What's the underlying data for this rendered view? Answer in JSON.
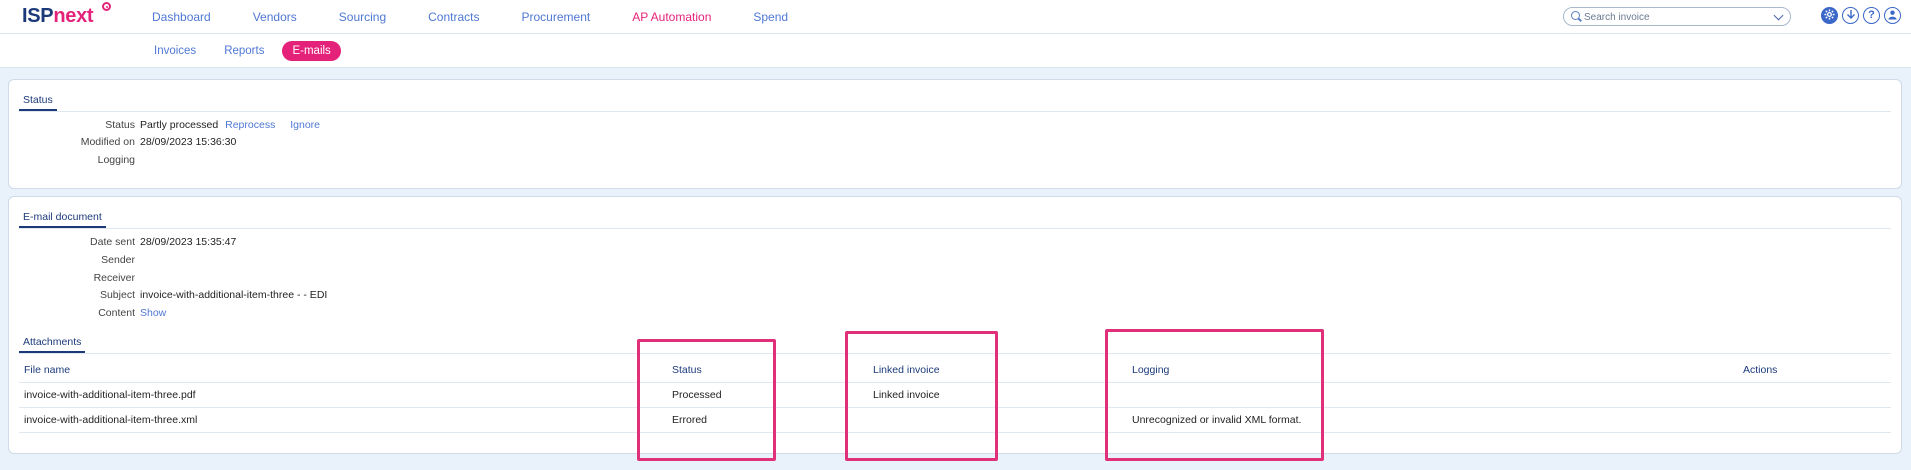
{
  "logo": {
    "part1": "ISP",
    "part2": "next"
  },
  "nav": {
    "items": [
      {
        "label": "Dashboard",
        "active": false
      },
      {
        "label": "Vendors",
        "active": false
      },
      {
        "label": "Sourcing",
        "active": false
      },
      {
        "label": "Contracts",
        "active": false
      },
      {
        "label": "Procurement",
        "active": false
      },
      {
        "label": "AP Automation",
        "active": true
      },
      {
        "label": "Spend",
        "active": false
      }
    ]
  },
  "search": {
    "placeholder": "Search invoice",
    "value": ""
  },
  "header_icons": [
    "gear-icon",
    "download-icon",
    "help-icon",
    "user-icon"
  ],
  "subnav": {
    "items": [
      {
        "label": "Invoices",
        "active": false
      },
      {
        "label": "Reports",
        "active": false
      },
      {
        "label": "E-mails",
        "active": true
      }
    ]
  },
  "status_section": {
    "title": "Status",
    "status_label": "Status",
    "status_value": "Partly processed",
    "reprocess": "Reprocess",
    "ignore": "Ignore",
    "modified_label": "Modified on",
    "modified_value": "28/09/2023 15:36:30",
    "logging_label": "Logging",
    "logging_value": ""
  },
  "email_section": {
    "title": "E-mail document",
    "date_sent_label": "Date sent",
    "date_sent_value": "28/09/2023 15:35:47",
    "sender_label": "Sender",
    "sender_value": "",
    "receiver_label": "Receiver",
    "receiver_value": "",
    "subject_label": "Subject",
    "subject_value": "invoice-with-additional-item-three - - EDI",
    "content_label": "Content",
    "content_link": "Show"
  },
  "attachments": {
    "title": "Attachments",
    "columns": [
      "File name",
      "Status",
      "Linked invoice",
      "Logging",
      "Actions"
    ],
    "rows": [
      {
        "file": "invoice-with-additional-item-three.pdf",
        "status": "Processed",
        "linked": "Linked invoice",
        "logging": ""
      },
      {
        "file": "invoice-with-additional-item-three.xml",
        "status": "Errored",
        "linked": "",
        "logging": "Unrecognized or invalid XML format."
      }
    ]
  },
  "colors": {
    "brand_dark": "#1c3a7a",
    "brand_pink": "#e5227a",
    "link": "#4f78d4",
    "highlight": "#e0307a"
  }
}
